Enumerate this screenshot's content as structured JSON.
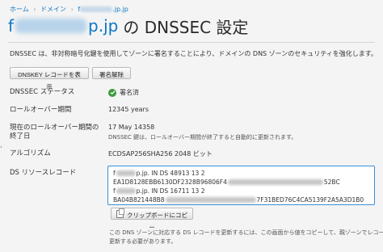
{
  "breadcrumb": {
    "home": "ホーム",
    "domain": "ドメイン",
    "current_prefix": "f",
    "current_suffix": ".jp.jp"
  },
  "title": {
    "domain_prefix": "f",
    "domain_suffix": "p.jp",
    "rest": "の DNSSEC 設定"
  },
  "description": "DNSSEC は、非対称暗号化鍵を使用してゾーンに署名することにより、ドメインの DNS ゾーンのセキュリティを強化します。",
  "buttons": {
    "dnskey": "DNSKEY レコードを表示",
    "unsign": "署名解除",
    "copy": "クリップボードにコピー"
  },
  "fields": {
    "status_label": "DNSSEC ステータス",
    "status_value": "署名済",
    "rollover_label": "ロールオーバー期間",
    "rollover_value": "12345 years",
    "current_label": "現在のロールオーバー期間の終了日",
    "current_date": "17 May 14358",
    "current_note": "DNSSEC 鍵は、ロールオーバー期間が終了すると自動的に更新されます。",
    "algo_label": "アルゴリズム",
    "algo_value": "ECDSAP256SHA256 2048 ビット",
    "ds_label": "DS リソースレコード"
  },
  "ds_record": {
    "line1_prefix": "f",
    "line1_suffix": "p.jp. IN DS 48913 13 2",
    "line2_prefix": "EA1D8128EBB6130DF2328B96806F4",
    "line2_suffix": "52BC",
    "line3_prefix": "f",
    "line3_suffix": "p.jp. IN DS 16711 13 2",
    "line4_prefix": "BA04B821448B8",
    "line4_suffix": "7F31BED76C4CA5139F2A5A3D1B0"
  },
  "footnote": {
    "line1": "この DNS ゾーンに対応する DS レコードを更新するには、この画面から値をコピーして、親ゾーンでレコードを",
    "line2": "更新する必要があります。"
  },
  "colors": {
    "link": "#0b76c5",
    "focus": "#3b8fd6",
    "status_ok": "#3a9b3a"
  },
  "icons": {
    "status": "check-circle-icon",
    "copy": "copy-icon",
    "side": "chevron-left-icon"
  }
}
